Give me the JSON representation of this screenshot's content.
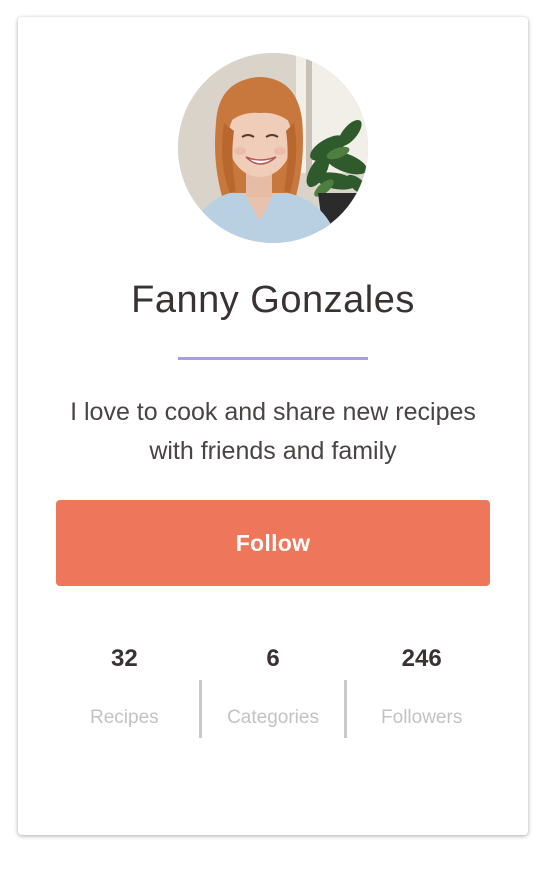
{
  "profile": {
    "name": "Fanny Gonzales",
    "bio": "I love to cook and share new recipes with friends and family",
    "avatar_alt": "Fanny Gonzales"
  },
  "actions": {
    "follow_label": "Follow"
  },
  "stats": [
    {
      "value": "32",
      "label": "Recipes"
    },
    {
      "value": "6",
      "label": "Categories"
    },
    {
      "value": "246",
      "label": "Followers"
    }
  ],
  "colors": {
    "accent_divider": "#a99ee0",
    "follow_button": "#ee765a",
    "text_dark": "#3a3232",
    "text_muted": "#c4c2c2"
  }
}
